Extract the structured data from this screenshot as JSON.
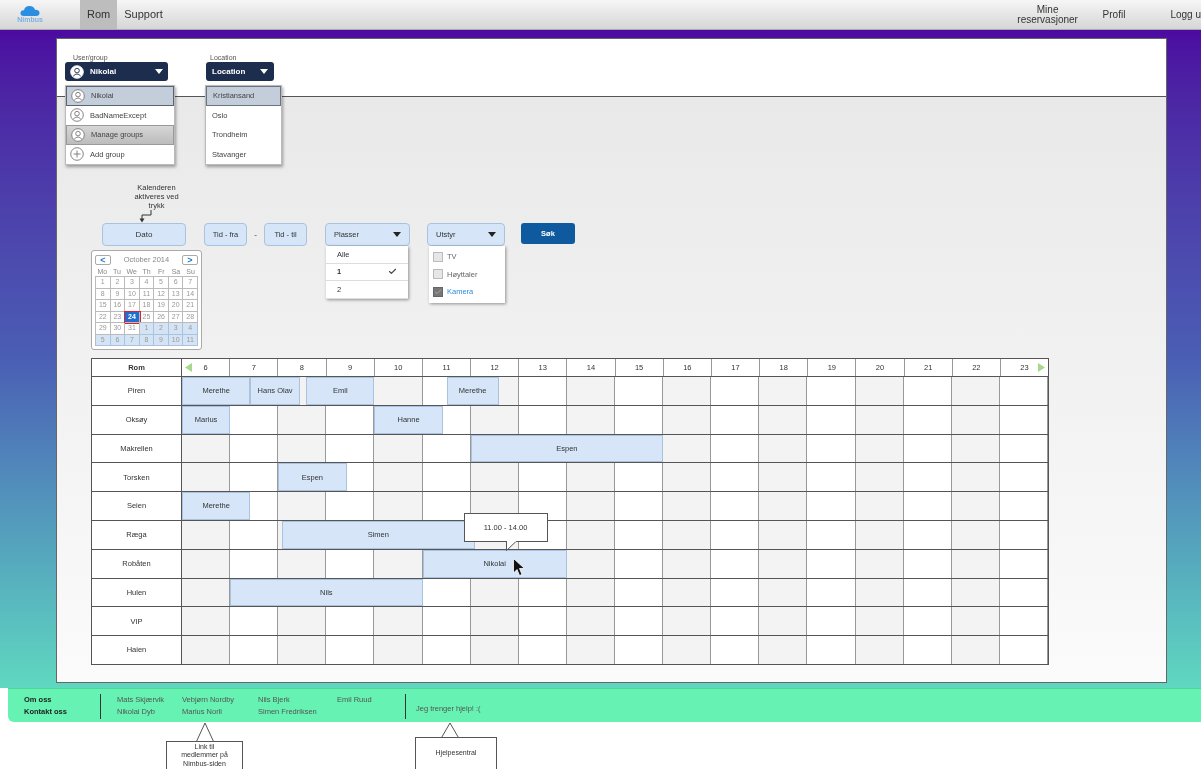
{
  "nav": {
    "logo": "Nimbus",
    "tabs": [
      {
        "label": "Rom",
        "selected": true
      },
      {
        "label": "Support",
        "selected": false
      }
    ],
    "links": [
      "Mine reservasjoner",
      "Profil",
      "Logg u"
    ]
  },
  "user_group": {
    "label": "User/group",
    "value": "Nikolai",
    "items": [
      {
        "kind": "user",
        "label": "Nikolai",
        "selected": true,
        "hovered": false
      },
      {
        "kind": "user",
        "label": "BadNameExcept",
        "selected": false,
        "hovered": false
      },
      {
        "kind": "manage",
        "label": "Manage groups",
        "selected": false,
        "hovered": true
      },
      {
        "kind": "add",
        "label": "Add group",
        "selected": false,
        "hovered": false
      }
    ]
  },
  "location": {
    "label": "Location",
    "value": "Location",
    "items": [
      {
        "label": "Kristiansand",
        "selected": true
      },
      {
        "label": "Oslo",
        "selected": false
      },
      {
        "label": "Trondheim",
        "selected": false
      },
      {
        "label": "Stavanger",
        "selected": false
      }
    ]
  },
  "calendar_note": "Kalenderen aktiveres ved trykk",
  "filters": {
    "date": "Dato",
    "time_from": "Tid - fra",
    "separator": "-",
    "time_to": "Tid - til",
    "places": {
      "label": "Plasser",
      "options": [
        {
          "label": "Alle",
          "selected": false
        },
        {
          "label": "1",
          "selected": true
        },
        {
          "label": "2",
          "selected": false
        }
      ]
    },
    "equipment": {
      "label": "Utstyr",
      "options": [
        {
          "label": "TV",
          "checked": false
        },
        {
          "label": "Høyttaler",
          "checked": false
        },
        {
          "label": "Kamera",
          "checked": true
        }
      ]
    },
    "search": "Søk"
  },
  "calendar": {
    "prev": "<",
    "month": "October 2014",
    "next": ">",
    "weekdays": [
      "Mo",
      "Tu",
      "We",
      "Th",
      "Fr",
      "Sa",
      "Su"
    ],
    "days": [
      {
        "label": "1",
        "other_month": false,
        "selected": false
      },
      {
        "label": "2",
        "other_month": false,
        "selected": false
      },
      {
        "label": "3",
        "other_month": false,
        "selected": false
      },
      {
        "label": "4",
        "other_month": false,
        "selected": false
      },
      {
        "label": "5",
        "other_month": false,
        "selected": false
      },
      {
        "label": "6",
        "other_month": false,
        "selected": false
      },
      {
        "label": "7",
        "other_month": false,
        "selected": false
      },
      {
        "label": "8",
        "other_month": false,
        "selected": false
      },
      {
        "label": "9",
        "other_month": false,
        "selected": false
      },
      {
        "label": "10",
        "other_month": false,
        "selected": false
      },
      {
        "label": "11",
        "other_month": false,
        "selected": false
      },
      {
        "label": "12",
        "other_month": false,
        "selected": false
      },
      {
        "label": "13",
        "other_month": false,
        "selected": false
      },
      {
        "label": "14",
        "other_month": false,
        "selected": false
      },
      {
        "label": "15",
        "other_month": false,
        "selected": false
      },
      {
        "label": "16",
        "other_month": false,
        "selected": false
      },
      {
        "label": "17",
        "other_month": false,
        "selected": false
      },
      {
        "label": "18",
        "other_month": false,
        "selected": false
      },
      {
        "label": "19",
        "other_month": false,
        "selected": false
      },
      {
        "label": "20",
        "other_month": false,
        "selected": false
      },
      {
        "label": "21",
        "other_month": false,
        "selected": false
      },
      {
        "label": "22",
        "other_month": false,
        "selected": false
      },
      {
        "label": "23",
        "other_month": false,
        "selected": false
      },
      {
        "label": "24",
        "other_month": false,
        "selected": true
      },
      {
        "label": "25",
        "other_month": false,
        "selected": false
      },
      {
        "label": "26",
        "other_month": false,
        "selected": false
      },
      {
        "label": "27",
        "other_month": false,
        "selected": false
      },
      {
        "label": "28",
        "other_month": false,
        "selected": false
      },
      {
        "label": "29",
        "other_month": false,
        "selected": false
      },
      {
        "label": "30",
        "other_month": false,
        "selected": false
      },
      {
        "label": "31",
        "other_month": false,
        "selected": false
      },
      {
        "label": "1",
        "other_month": true,
        "selected": false
      },
      {
        "label": "2",
        "other_month": true,
        "selected": false
      },
      {
        "label": "3",
        "other_month": true,
        "selected": false
      },
      {
        "label": "4",
        "other_month": true,
        "selected": false
      },
      {
        "label": "5",
        "other_month": true,
        "selected": false
      },
      {
        "label": "6",
        "other_month": true,
        "selected": false
      },
      {
        "label": "7",
        "other_month": true,
        "selected": false
      },
      {
        "label": "8",
        "other_month": true,
        "selected": false
      },
      {
        "label": "9",
        "other_month": true,
        "selected": false
      },
      {
        "label": "10",
        "other_month": true,
        "selected": false
      },
      {
        "label": "11",
        "other_month": true,
        "selected": false
      }
    ]
  },
  "schedule": {
    "room_heading": "Rom",
    "hours": [
      "6",
      "7",
      "8",
      "9",
      "10",
      "11",
      "12",
      "13",
      "14",
      "15",
      "16",
      "17",
      "18",
      "19",
      "20",
      "21",
      "22",
      "23"
    ],
    "rows": [
      {
        "room": "Piren",
        "bookings": [
          {
            "name": "Merethe"
          },
          {
            "name": "Hans Olav"
          },
          {
            "name": "Emil"
          },
          {
            "name": "Merethe"
          }
        ]
      },
      {
        "room": "Oksøy",
        "bookings": [
          {
            "name": "Marius"
          },
          {
            "name": "Hanne"
          }
        ]
      },
      {
        "room": "Makrellen",
        "bookings": [
          {
            "name": "Espen"
          }
        ]
      },
      {
        "room": "Torsken",
        "bookings": [
          {
            "name": "Espen"
          }
        ]
      },
      {
        "room": "Seien",
        "bookings": [
          {
            "name": "Merethe"
          }
        ]
      },
      {
        "room": "Ræga",
        "bookings": [
          {
            "name": "Simen"
          }
        ]
      },
      {
        "room": "Robåten",
        "bookings": [
          {
            "name": "Nikolai",
            "tooltip": "11.00 - 14.00"
          }
        ]
      },
      {
        "room": "Hulen",
        "bookings": [
          {
            "name": "Nils"
          }
        ]
      },
      {
        "room": "VIP"
      },
      {
        "room": "Haien"
      }
    ]
  },
  "footer": {
    "links": [
      "Om oss",
      "Kontakt oss"
    ],
    "member_columns": [
      [
        "Mats Skjærvik",
        "Nikolai Dyb"
      ],
      [
        "Vebjørn Nordby",
        "Marius Norli"
      ],
      [
        "Nils Bjerk",
        "Simen Fredriksen"
      ],
      [
        "Emil Ruud"
      ]
    ],
    "help": "Jeg trenger hjelp! :("
  },
  "notes": [
    "Link til medlemmer på Nimbus-siden",
    "Hjelpesentral"
  ]
}
